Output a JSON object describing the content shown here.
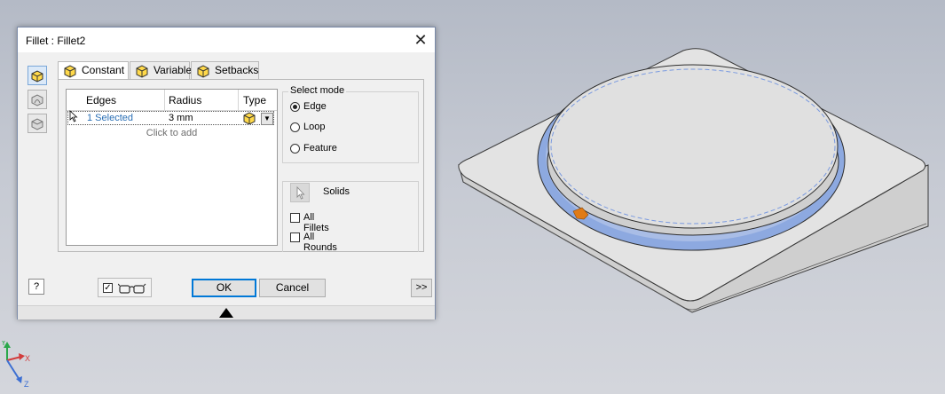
{
  "dialog": {
    "title": "Fillet : Fillet2",
    "close_glyph": "✕",
    "mode_icons": [
      "fillet-edge-icon",
      "fillet-face-icon",
      "fillet-full-round-icon"
    ],
    "tabs": [
      {
        "label": "Constant",
        "icon": "constant-fillet-icon"
      },
      {
        "label": "Variable",
        "icon": "variable-fillet-icon"
      },
      {
        "label": "Setbacks",
        "icon": "setbacks-fillet-icon"
      }
    ],
    "grid": {
      "headers": [
        "Edges",
        "Radius",
        "Type"
      ],
      "row": {
        "edges": "1 Selected",
        "radius": "3 mm",
        "type_icon": "fillet-type-icon"
      },
      "click_to_add": "Click to add"
    },
    "select_mode": {
      "label": "Select mode",
      "options": [
        "Edge",
        "Loop",
        "Feature"
      ],
      "selected": "Edge"
    },
    "solids": {
      "label": "Solids",
      "icon": "select-solid-icon"
    },
    "checkboxes": [
      "All Fillets",
      "All Rounds"
    ],
    "help_glyph": "?",
    "ok_label": "OK",
    "cancel_label": "Cancel",
    "more_label": ">>",
    "preview_icon": "glasses-preview-icon"
  },
  "viewcube_axes": {
    "x": "X",
    "y": "Y",
    "z": "Z"
  },
  "colors": {
    "accent": "#0078d7",
    "selection_highlight": "#7ea4e6",
    "link_blue": "#2a6fb5",
    "pointer_orange": "#e07b17"
  }
}
